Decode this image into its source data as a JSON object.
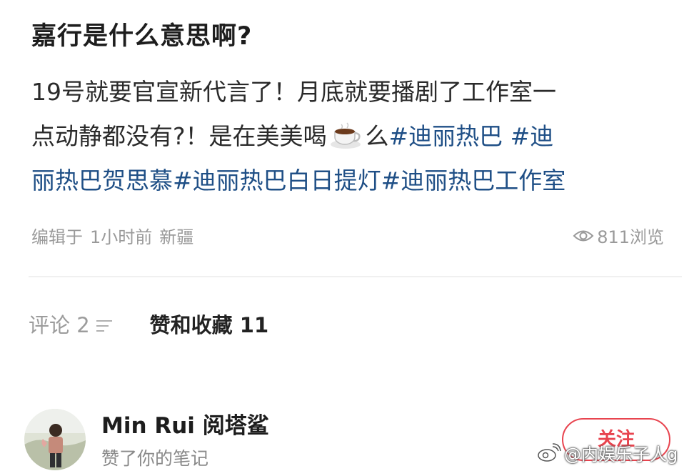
{
  "note": {
    "title": "嘉行是什么意思啊?",
    "body_line1": "19号就要官宣新代言了！月底就要播剧了工作室一",
    "body_line2_text": "点动静都没有?！是在美美喝",
    "body_line2_after_icon": "么",
    "body_line2_tag": "#迪丽热巴 #迪",
    "body_line3_tag": "丽热巴贺思慕#迪丽热巴白日提灯#迪丽热巴工作室",
    "icon_in_text": "coffee-cup-icon",
    "tag_color": "#1f4f86"
  },
  "meta": {
    "edited": "编辑于",
    "time": "1小时前",
    "location": "新疆",
    "views": "811浏览",
    "views_icon": "eye-icon"
  },
  "tabs": {
    "comments": "评论 2",
    "sort_icon": "sort-icon",
    "likes": "赞和收藏 11"
  },
  "interaction": {
    "user_name": "Min Rui 阅塔鲨",
    "action": "赞了你的笔记",
    "follow_label": "关注",
    "accent_color": "#e8444f"
  },
  "watermark": {
    "text": "@内娱乐子人g",
    "sub_text": "……",
    "icon": "weibo-icon"
  }
}
